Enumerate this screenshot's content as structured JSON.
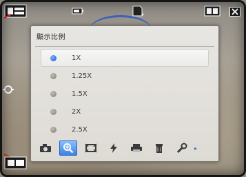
{
  "panel": {
    "title": "顯示比例",
    "options": [
      {
        "label": "1X",
        "selected": true
      },
      {
        "label": "1.25X",
        "selected": false
      },
      {
        "label": "1.5X",
        "selected": false
      },
      {
        "label": "2X",
        "selected": false
      },
      {
        "label": "2.5X",
        "selected": false
      }
    ]
  },
  "toolbar": {
    "icons": [
      "camera-mode-icon",
      "zoom-icon",
      "frame-size-icon",
      "flash-icon",
      "print-icon",
      "delete-icon",
      "settings-wrench-icon"
    ],
    "active_index": 1,
    "more": "▸"
  },
  "colors": {
    "accent": "#2f66d8",
    "panel_bg": "#e4e2de"
  }
}
